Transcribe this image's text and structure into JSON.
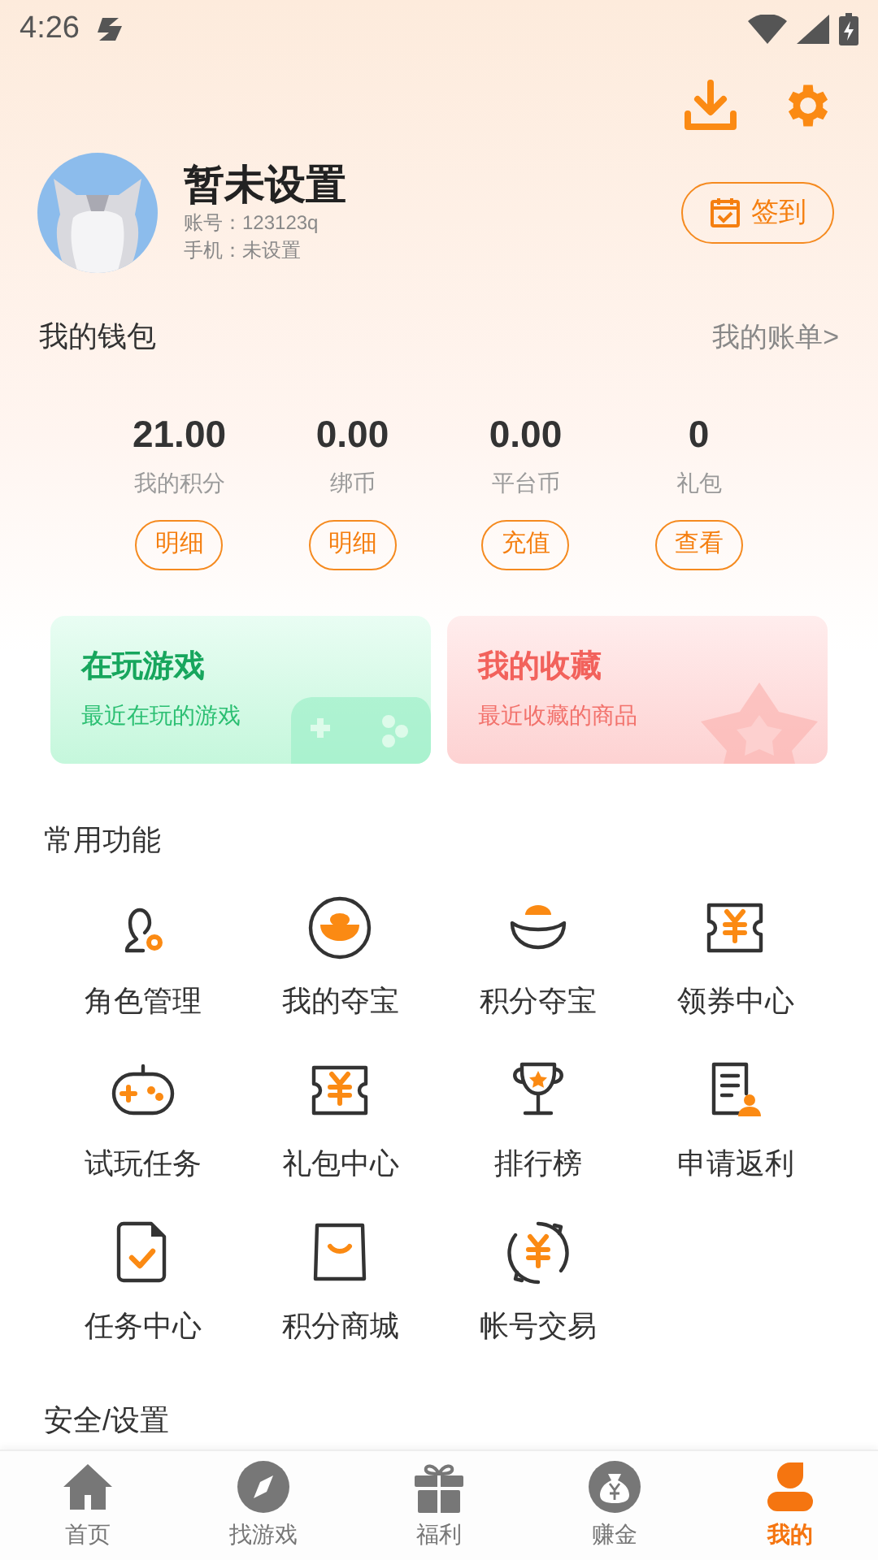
{
  "status_bar": {
    "time": "4:26"
  },
  "profile": {
    "name": "暂未设置",
    "account": "账号：123123q",
    "phone": "手机：未设置",
    "checkin_button": "签到"
  },
  "wallet": {
    "title": "我的钱包",
    "bill_link": "我的账单>",
    "stats": [
      {
        "value": "21.00",
        "label": "我的积分",
        "button": "明细"
      },
      {
        "value": "0.00",
        "label": "绑币",
        "button": "明细"
      },
      {
        "value": "0.00",
        "label": "平台币",
        "button": "充值"
      },
      {
        "value": "0",
        "label": "礼包",
        "button": "查看"
      }
    ]
  },
  "cards": [
    {
      "kind": "games",
      "title": "在玩游戏",
      "subtitle": "最近在玩的游戏"
    },
    {
      "kind": "favorites",
      "title": "我的收藏",
      "subtitle": "最近收藏的商品"
    }
  ],
  "functions": {
    "title": "常用功能",
    "items": [
      {
        "kind": "role",
        "label": "角色管理"
      },
      {
        "kind": "ingot",
        "label": "我的夺宝"
      },
      {
        "kind": "bowl",
        "label": "积分夺宝"
      },
      {
        "kind": "coupon",
        "label": "领券中心"
      },
      {
        "kind": "gamepad",
        "label": "试玩任务"
      },
      {
        "kind": "coupon",
        "label": "礼包中心"
      },
      {
        "kind": "trophy",
        "label": "排行榜"
      },
      {
        "kind": "document",
        "label": "申请返利"
      },
      {
        "kind": "task",
        "label": "任务中心"
      },
      {
        "kind": "bag",
        "label": "积分商城"
      },
      {
        "kind": "exchange",
        "label": "帐号交易"
      }
    ]
  },
  "security_title": "安全/设置",
  "tab_bar": [
    {
      "kind": "home",
      "label": "首页",
      "selected": false
    },
    {
      "kind": "compass",
      "label": "找游戏",
      "selected": false
    },
    {
      "kind": "gift",
      "label": "福利",
      "selected": false
    },
    {
      "kind": "money",
      "label": "赚金",
      "selected": false
    },
    {
      "kind": "user",
      "label": "我的",
      "selected": true
    }
  ]
}
